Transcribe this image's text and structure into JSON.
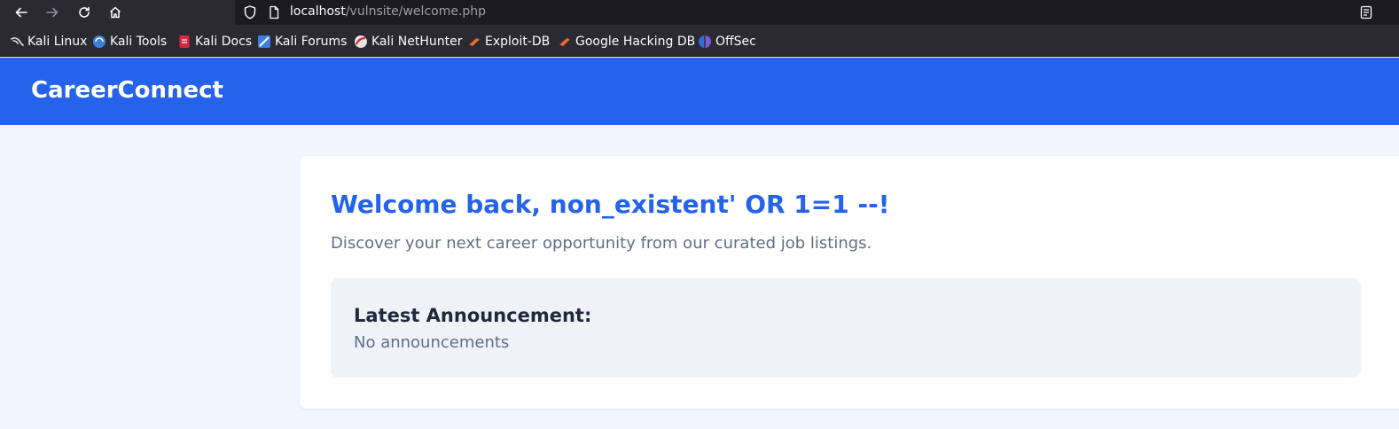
{
  "browser": {
    "url_host": "localhost",
    "url_path": "/vulnsite/welcome.php",
    "bookmarks": [
      {
        "label": "Kali Linux",
        "icon": "kali-dragon-icon"
      },
      {
        "label": "Kali Tools",
        "icon": "kali-tools-icon"
      },
      {
        "label": "Kali Docs",
        "icon": "kali-docs-icon"
      },
      {
        "label": "Kali Forums",
        "icon": "kali-forums-icon"
      },
      {
        "label": "Kali NetHunter",
        "icon": "kali-nethunter-icon"
      },
      {
        "label": "Exploit-DB",
        "icon": "exploit-db-icon"
      },
      {
        "label": "Google Hacking DB",
        "icon": "ghdb-icon"
      },
      {
        "label": "OffSec",
        "icon": "offsec-icon"
      }
    ]
  },
  "site": {
    "brand": "CareerConnect",
    "brand_color": "#2563eb"
  },
  "main": {
    "welcome": "Welcome back, non_existent' OR 1=1 --!",
    "subtitle": "Discover your next career opportunity from our curated job listings.",
    "announcement_title": "Latest Announcement:",
    "announcement_body": "No announcements"
  }
}
